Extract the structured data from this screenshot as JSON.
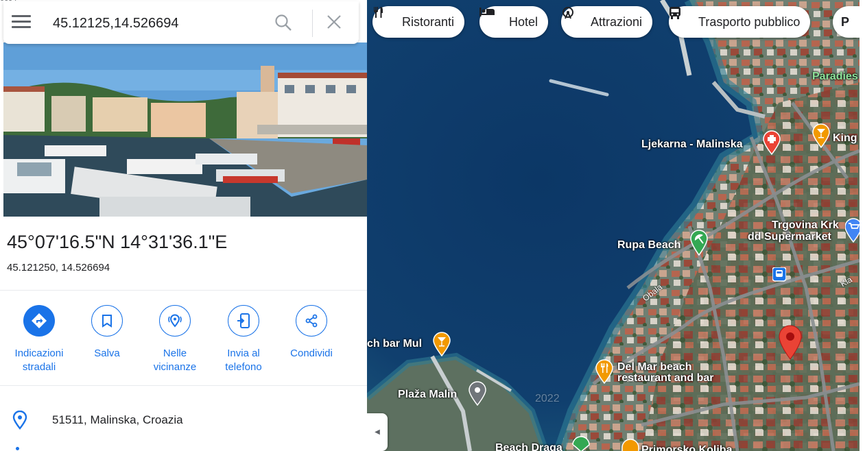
{
  "search": {
    "query": "45.12125,14.526694",
    "clipped_text": "0694"
  },
  "place": {
    "coords_dms": "45°07'16.5\"N 14°31'36.1\"E",
    "coords_decimal": "45.121250, 14.526694",
    "address": "51511, Malinska, Croazia"
  },
  "actions": [
    {
      "name": "directions",
      "line1": "Indicazioni",
      "line2": "stradali",
      "icon": "directions-icon"
    },
    {
      "name": "save",
      "line1": "Salva",
      "line2": "",
      "icon": "bookmark-icon"
    },
    {
      "name": "nearby",
      "line1": "Nelle",
      "line2": "vicinanze",
      "icon": "nearby-icon"
    },
    {
      "name": "send",
      "line1": "Invia al",
      "line2": "telefono",
      "icon": "phone-send-icon"
    },
    {
      "name": "share",
      "line1": "Condividi",
      "line2": "",
      "icon": "share-icon"
    }
  ],
  "chips": [
    {
      "label": "Ristoranti",
      "icon": "restaurant-icon"
    },
    {
      "label": "Hotel",
      "icon": "hotel-icon"
    },
    {
      "label": "Attrazioni",
      "icon": "attractions-icon"
    },
    {
      "label": "Trasporto pubblico",
      "icon": "transit-icon"
    },
    {
      "label": "P",
      "icon": ""
    }
  ],
  "map_labels": {
    "ljekarna": "Ljekarna - Malinska",
    "king": "King",
    "paradies": "Paradies",
    "trgovina1": "Trgovina Krk",
    "trgovina2": "dd Supermarket",
    "rupa": "Rupa Beach",
    "obala": "Obala",
    "kla": "Kla",
    "beachbar": "ch bar Mul",
    "delmar1": "Del Mar beach",
    "delmar2": "restaurant and bar",
    "plaza": "Plaža Malin",
    "draga": "Beach Draga",
    "primorsko": "Primorsko Koliba",
    "watermark": "2022"
  },
  "colors": {
    "accent": "#1a73e8",
    "water": "#0f3a63",
    "pin_red": "#ea4335",
    "poi_orange": "#f29900",
    "poi_green": "#34a853"
  }
}
